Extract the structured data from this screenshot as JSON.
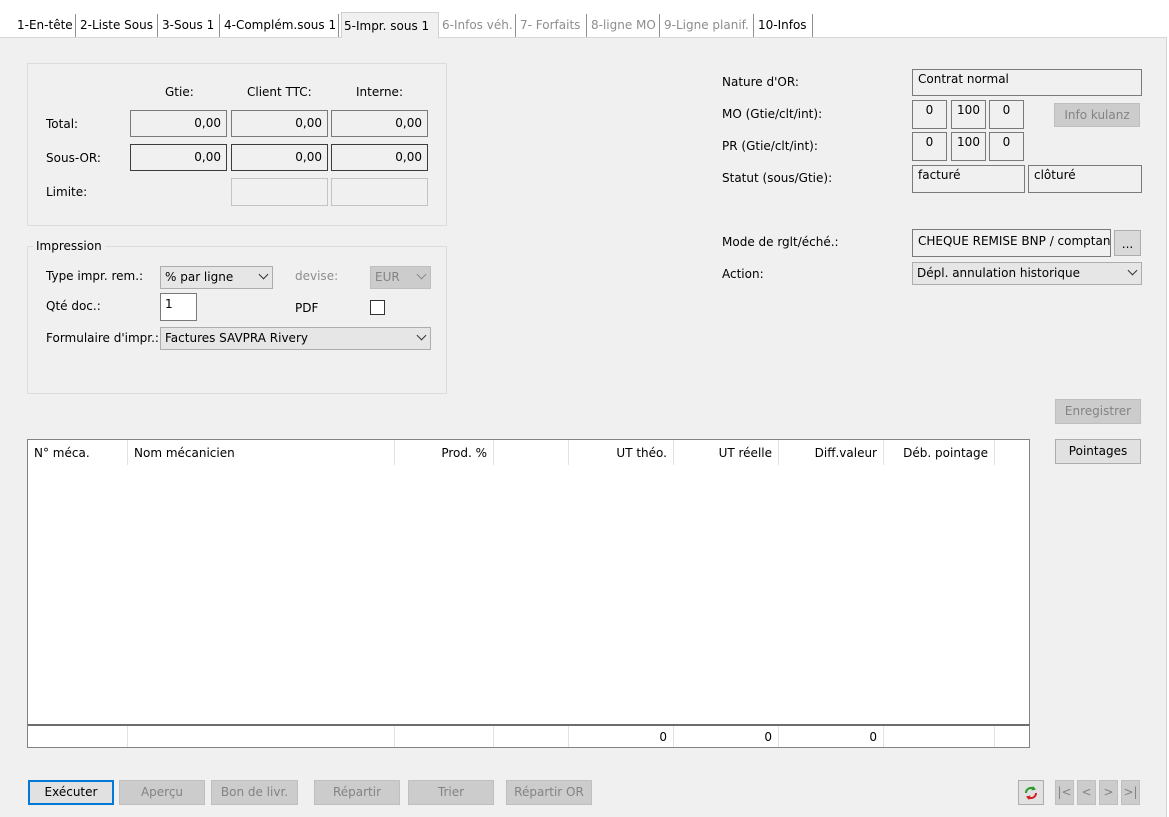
{
  "tabs": [
    {
      "label": "1-En-tête",
      "state": "normal"
    },
    {
      "label": "2-Liste Sous",
      "state": "normal"
    },
    {
      "label": "3-Sous 1",
      "state": "normal"
    },
    {
      "label": "4-Complém.sous 1",
      "state": "normal"
    },
    {
      "label": "5-Impr. sous 1",
      "state": "active"
    },
    {
      "label": "6-Infos véh.",
      "state": "disabled"
    },
    {
      "label": "7- Forfaits",
      "state": "disabled"
    },
    {
      "label": "8-ligne MO",
      "state": "disabled"
    },
    {
      "label": "9-Ligne planif.",
      "state": "disabled"
    },
    {
      "label": "10-Infos",
      "state": "normal"
    }
  ],
  "totals": {
    "col_gtie": "Gtie:",
    "col_client": "Client TTC:",
    "col_interne": "Interne:",
    "row_total_label": "Total:",
    "row_sousor_label": "Sous-OR:",
    "row_limite_label": "Limite:",
    "total": {
      "gtie": "0,00",
      "client": "0,00",
      "interne": "0,00"
    },
    "sousor": {
      "gtie": "0,00",
      "client": "0,00",
      "interne": "0,00"
    },
    "limite": {
      "client": "",
      "interne": ""
    }
  },
  "impression": {
    "title": "Impression",
    "type_label": "Type impr. rem.:",
    "type_value": "% par ligne",
    "devise_label": "devise:",
    "devise_value": "EUR",
    "qte_label": "Qté doc.:",
    "qte_value": "1",
    "pdf_label": "PDF",
    "pdf_checked": false,
    "formulaire_label": "Formulaire d'impr.:",
    "formulaire_value": "Factures SAVPRA Rivery"
  },
  "right": {
    "nature_label": "Nature d'OR:",
    "nature_value": "Contrat normal",
    "mo_label": "MO (Gtie/clt/int):",
    "mo_values": [
      "0",
      "100",
      "0"
    ],
    "pr_label": "PR (Gtie/clt/int):",
    "pr_values": [
      "0",
      "100",
      "0"
    ],
    "info_kulanz": "Info kulanz",
    "statut_label": "Statut (sous/Gtie):",
    "statut_sous": "facturé",
    "statut_gtie": "clôturé",
    "mode_label": "Mode de rglt/éché.:",
    "mode_value": "CHEQUE REMISE BNP / comptant",
    "mode_btn": "...",
    "action_label": "Action:",
    "action_value": "Dépl. annulation historique",
    "enregistrer": "Enregistrer",
    "pointages": "Pointages"
  },
  "grid": {
    "columns": [
      "N° méca.",
      "Nom mécanicien",
      "Prod. %",
      "",
      "UT théo.",
      "UT réelle",
      "Diff.valeur",
      "Déb. pointage"
    ],
    "rows": [],
    "footer": [
      "",
      "",
      "",
      "",
      "0",
      "0",
      "0",
      ""
    ]
  },
  "bottom": {
    "executer": "Exécuter",
    "apercu": "Aperçu",
    "bon_livr": "Bon de livr.",
    "repartir": "Répartir",
    "trier": "Trier",
    "repartir_or": "Répartir OR",
    "nav_first": "|<",
    "nav_prev": "<",
    "nav_next": ">",
    "nav_last": ">|"
  }
}
